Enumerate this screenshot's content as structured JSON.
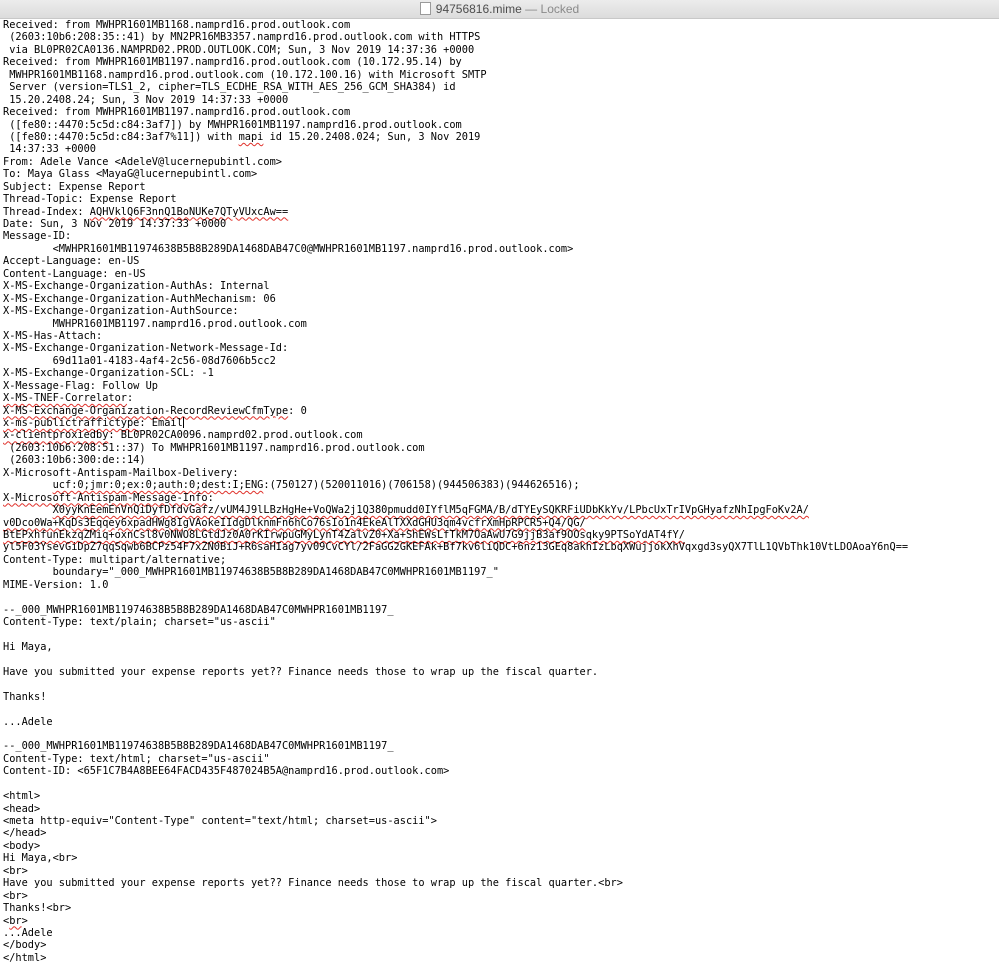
{
  "window": {
    "filename": "94756816.mime",
    "separator": "—",
    "status": "Locked",
    "icon": "document-icon"
  },
  "document": {
    "lines": [
      "Received: from MWHPR1601MB1168.namprd16.prod.outlook.com",
      " (2603:10b6:208:35::41) by MN2PR16MB3357.namprd16.prod.outlook.com with HTTPS",
      " via BL0PR02CA0136.NAMPRD02.PROD.OUTLOOK.COM; Sun, 3 Nov 2019 14:37:36 +0000",
      "Received: from MWHPR1601MB1197.namprd16.prod.outlook.com (10.172.95.14) by",
      " MWHPR1601MB1168.namprd16.prod.outlook.com (10.172.100.16) with Microsoft SMTP",
      " Server (version=TLS1_2, cipher=TLS_ECDHE_RSA_WITH_AES_256_GCM_SHA384) id",
      " 15.20.2408.24; Sun, 3 Nov 2019 14:37:33 +0000",
      "Received: from MWHPR1601MB1197.namprd16.prod.outlook.com",
      " ([fe80::4470:5c5d:c84:3af7]) by MWHPR1601MB1197.namprd16.prod.outlook.com",
      " ([fe80::4470:5c5d:c84:3af7%11]) with mapi id 15.20.2408.024; Sun, 3 Nov 2019",
      " 14:37:33 +0000",
      "From: Adele Vance <AdeleV@lucernepubintl.com>",
      "To: Maya Glass <MayaG@lucernepubintl.com>",
      "Subject: Expense Report",
      "Thread-Topic: Expense Report",
      "Thread-Index: AQHVklQ6F3nnQ1BoNUKe7QTyVUxcAw==",
      "Date: Sun, 3 Nov 2019 14:37:33 +0000",
      "Message-ID:",
      "        <MWHPR1601MB11974638B5B8B289DA1468DAB47C0@MWHPR1601MB1197.namprd16.prod.outlook.com>",
      "Accept-Language: en-US",
      "Content-Language: en-US",
      "X-MS-Exchange-Organization-AuthAs: Internal",
      "X-MS-Exchange-Organization-AuthMechanism: 06",
      "X-MS-Exchange-Organization-AuthSource:",
      "        MWHPR1601MB1197.namprd16.prod.outlook.com",
      "X-MS-Has-Attach:",
      "X-MS-Exchange-Organization-Network-Message-Id:",
      "        69d11a01-4183-4af4-2c56-08d7606b5cc2",
      "X-MS-Exchange-Organization-SCL: -1",
      "X-Message-Flag: Follow Up",
      "X-MS-TNEF-Correlator:",
      "X-MS-Exchange-Organization-RecordReviewCfmType: 0",
      "x-ms-publictraffictype: Email",
      "x-clientproxiedby: BL0PR02CA0096.namprd02.prod.outlook.com",
      " (2603:10b6:208:51::37) To MWHPR1601MB1197.namprd16.prod.outlook.com",
      " (2603:10b6:300:de::14)",
      "X-Microsoft-Antispam-Mailbox-Delivery:",
      "        ucf:0;jmr:0;ex:0;auth:0;dest:I;ENG:(750127)(520011016)(706158)(944506383)(944626516);",
      "X-Microsoft-Antispam-Message-Info:",
      "        X0yyKnEemEnVnQiDyfDfdvGafz/vUM4J9lLBzHgHe+VoQWa2j1Q380pmudd0IYflM5qFGMA/B/dTYEySQKRFiUDbKkYv/LPbcUxTrIVpGHyafzNhIpgFoKv2A/",
      "v0Dco0Wa+KqDs3Eqqey6xpadHWg8IgVAokeIIdgDlknmFn6hCo76sIo1n4EkeAlTXXdGHU3qm4vcfrXmHpRPCR5+Q4/QG/",
      "BtEPxhfunEkzqZMiq+oxnCsl8v0NWO8LGtdJz0A0rKIrwpuGMyLynT4ZalvZ0+Xa+ShEWsLfTkM7OaAwU7G9jjB3af9OOsqky9PTSoYdAT4fY/",
      "yl5F03YsevGiDpZ7qqSqwb6BCPz54F7xZN0BiJ+R6saHIag7yv09CvCYl/2FaGG2GKEFAk+Bf7kv6liQDC+6nz13GEq8akhIzLbqXWujjokXhVqxgd3syQX7TlL1QVbThk10VtLDOAoaY6nQ==",
      "Content-Type: multipart/alternative;",
      "        boundary=\"_000_MWHPR1601MB11974638B5B8B289DA1468DAB47C0MWHPR1601MB1197_\"",
      "MIME-Version: 1.0",
      "",
      "--_000_MWHPR1601MB11974638B5B8B289DA1468DAB47C0MWHPR1601MB1197_",
      "Content-Type: text/plain; charset=\"us-ascii\"",
      "",
      "Hi Maya,",
      "",
      "Have you submitted your expense reports yet?? Finance needs those to wrap up the fiscal quarter.",
      "",
      "Thanks!",
      "",
      "...Adele",
      "",
      "--_000_MWHPR1601MB11974638B5B8B289DA1468DAB47C0MWHPR1601MB1197_",
      "Content-Type: text/html; charset=\"us-ascii\"",
      "Content-ID: <65F1C7B4A8BEE64FACD435F487024B5A@namprd16.prod.outlook.com>",
      "",
      "<html>",
      "<head>",
      "<meta http-equiv=\"Content-Type\" content=\"text/html; charset=us-ascii\">",
      "</head>",
      "<body>",
      "Hi Maya,<br>",
      "<br>",
      "Have you submitted your expense reports yet?? Finance needs those to wrap up the fiscal quarter.<br>",
      "<br>",
      "Thanks!<br>",
      "<br>",
      "...Adele",
      "</body>",
      "</html>"
    ],
    "squiggles": {
      "9": [
        "mapi"
      ],
      "15": [
        "AQHVklQ6F3nnQ1BoNUKe7QTyVUxcAw=="
      ],
      "30": [
        "X-MS-TNEF-Correlator"
      ],
      "31": [
        "X-MS-Exchange-Organization-RecordReviewCfmType"
      ],
      "32": [
        "x-ms-publictraffictype"
      ],
      "33": [
        "x-clientproxiedby"
      ],
      "37": [
        "ucf:0;jmr:0;ex:0;auth:0;dest:I;ENG"
      ],
      "38": [
        "X-Microsoft-Antispam-Message-Info"
      ],
      "39": [
        "X0yyKnEemEnVnQiDyfDfdvGafz/vUM4J9lLBzHgHe+VoQWa2j1Q380pmudd0IYflM5qFGMA/B/dTYEySQKRFiUDbKkYv/LPbcUxTrIVpGHyafzNhIpgFoKv2A/"
      ],
      "40": [
        "v0Dco0Wa+KqDs3Eqqey6xpadHWg8IgVAokeIIdgDlknmFn6hCo76sIo1n4EkeAlTXXdGHU3qm4vcfrXmHpRPCR5+Q4/QG/"
      ],
      "41": [
        "BtEPxhfunEkzqZMiq+oxnCsl8v0NWO8LGtdJz0A0rKIrwpuGMyLynT4ZalvZ0+Xa+ShEWsLfTkM7OaAwU7G9jjB3af9OOsqky9PTSoYdAT4fY/"
      ],
      "42": [
        "yl5F03YsevGiDpZ7qqSqwb6BCPz54F7xZN0BiJ+R6saHIag7yv09CvCYl/2FaGG2GKEFAk+Bf7kv6liQDC+6nz13GEq8akhIzLbqXWujjokXhVqxgd3syQX7TlL1QVbThk10VtLDOAoaY6nQ==="
      ],
      "67": [
        "http-equiv"
      ],
      "72": [
        "br"
      ],
      "74": [
        "br"
      ]
    },
    "caret_line": 32,
    "colors": {
      "text": "#000000",
      "squiggle": "#e0312b",
      "titlebar": "#e4e4e4"
    }
  }
}
